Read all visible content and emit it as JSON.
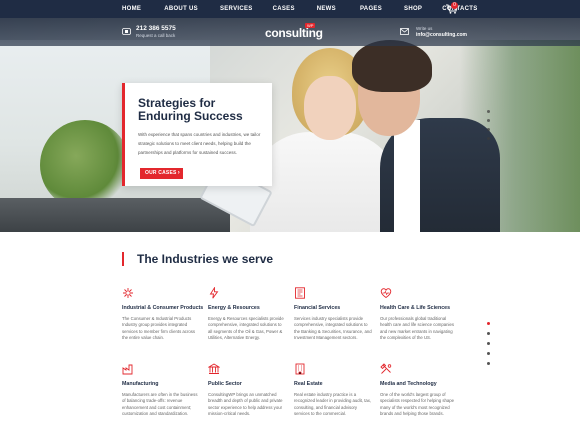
{
  "nav": {
    "items": [
      "HOME",
      "ABOUT US",
      "SERVICES",
      "CASES",
      "NEWS",
      "PAGES",
      "SHOP",
      "CONTACTS"
    ],
    "cart_count": "0"
  },
  "header": {
    "phone": "212 386 5575",
    "phone_sub": "Request a call back",
    "logo": "consulting",
    "logo_badge": "WP",
    "mail_sub": "Write us",
    "mail": "info@consulting.com"
  },
  "hero": {
    "title": "Strategies for Enduring Success",
    "text": "With experience that spans countries and industries, we tailor strategic solutions to meet client needs, helping build the partnerships and platforms for sustained success.",
    "button": "OUR CASES"
  },
  "industries": {
    "title": "The Industries we serve",
    "items": [
      {
        "icon": "industrial-icon",
        "name": "Industrial & Consumer Products",
        "desc": "The Consumer & Industrial Products Industry group provides integrated services to member firm clients across the entire value chain."
      },
      {
        "icon": "energy-icon",
        "name": "Energy & Resources",
        "desc": "Energy & Resources specialists provide comprehensive, integrated solutions to all segments of the Oil & Gas, Power & Utilities, Alternative Energy."
      },
      {
        "icon": "financial-icon",
        "name": "Financial Services",
        "desc": "Services industry specialists provide comprehensive, integrated solutions to the Banking & Securities, Insurance, and Investment Management sectors."
      },
      {
        "icon": "health-icon",
        "name": "Health Care & Life Sciences",
        "desc": "Our professionals global traditional health care and life science companies and new market entrants in navigating the complexities of the US."
      },
      {
        "icon": "manufacturing-icon",
        "name": "Manufacturing",
        "desc": "Manufacturers are often in the business of balancing trade-offs: revenue enhancement and cost containment; customization and standardization."
      },
      {
        "icon": "public-sector-icon",
        "name": "Public Sector",
        "desc": "ConsultingWP brings an unmatched breadth and depth of public and private sector experience to help address your mission-critical needs."
      },
      {
        "icon": "real-estate-icon",
        "name": "Real Estate",
        "desc": "Real estate industry practice is a recognized leader in providing audit, tax, consulting, and financial advisory services to the commercial."
      },
      {
        "icon": "media-tech-icon",
        "name": "Media and Technology",
        "desc": "One of the world's largest group of specialists respected for helping shape many of the world's most recognized brands and helping those brands."
      }
    ]
  },
  "colors": {
    "accent": "#e3272d",
    "navy": "#1f2c44"
  }
}
